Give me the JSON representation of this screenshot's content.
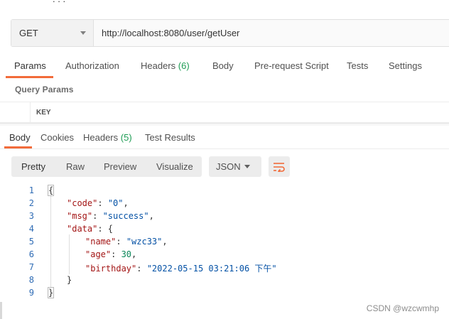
{
  "request": {
    "method": "GET",
    "url": "http://localhost:8080/user/getUser"
  },
  "request_tabs": [
    {
      "label": "Params",
      "count": ""
    },
    {
      "label": "Authorization",
      "count": ""
    },
    {
      "label": "Headers",
      "count": "(6)"
    },
    {
      "label": "Body",
      "count": ""
    },
    {
      "label": "Pre-request Script",
      "count": ""
    },
    {
      "label": "Tests",
      "count": ""
    },
    {
      "label": "Settings",
      "count": ""
    }
  ],
  "query_params": {
    "title": "Query Params",
    "key_header": "KEY"
  },
  "response_tabs": [
    {
      "label": "Body",
      "count": ""
    },
    {
      "label": "Cookies",
      "count": ""
    },
    {
      "label": "Headers",
      "count": "(5)"
    },
    {
      "label": "Test Results",
      "count": ""
    }
  ],
  "view_modes": [
    "Pretty",
    "Raw",
    "Preview",
    "Visualize"
  ],
  "format": "JSON",
  "line_numbers": [
    "1",
    "2",
    "3",
    "4",
    "5",
    "6",
    "7",
    "8",
    "9"
  ],
  "response_body": {
    "code_key": "\"code\"",
    "code_val": "\"0\"",
    "msg_key": "\"msg\"",
    "msg_val": "\"success\"",
    "data_key": "\"data\"",
    "name_key": "\"name\"",
    "name_val": "\"wzc33\"",
    "age_key": "\"age\"",
    "age_val": "30",
    "birthday_key": "\"birthday\"",
    "birthday_val": "\"2022-05-15 03:21:06 下午\""
  },
  "watermark": "CSDN @wzcwmhp",
  "colors": {
    "accent": "#f26b3a",
    "count_green": "#1f9d55",
    "json_key": "#a31515",
    "json_string": "#0451a5",
    "json_number": "#098658",
    "line_number": "#2f6cb5"
  }
}
